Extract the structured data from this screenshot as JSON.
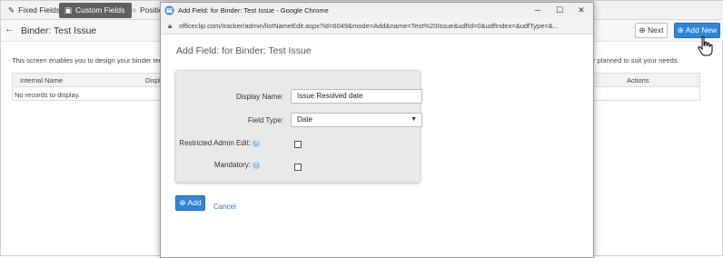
{
  "tabs": [
    {
      "icon": "pencil-icon",
      "label": "Fixed Fields"
    },
    {
      "icon": "save-icon",
      "label": "Custom Fields"
    },
    {
      "icon": "circle-icon",
      "label": "Positio"
    }
  ],
  "header": {
    "title": "Binder: Test Issue",
    "next_label": "Next",
    "add_new_label": "Add New"
  },
  "main": {
    "description_left": "This screen enables you to design your binder temp",
    "description_right": "r planned to suit your needs.",
    "grid": {
      "columns": [
        "Internal Name",
        "Displa",
        "Actions"
      ],
      "empty_text": "No records to display."
    }
  },
  "popup": {
    "window_title": "Add Field: for Binder: Test Issue - Google Chrome",
    "url": "officeclip.com/tracker/admin/listNameEdit.aspx?id=6049&mode=Add&name=Test%20Issue&udfId=0&udfIndex=&udfType=&...",
    "dialog_title": "Add Field: for Binder: Test Issue",
    "form": {
      "display_name_label": "Display Name:",
      "display_name_value": "Issue Resolved date",
      "field_type_label": "Field Type:",
      "field_type_value": "Date",
      "restricted_label": "Restricted Admin Edit:",
      "mandatory_label": "Mandatory:",
      "help_glyph": "?"
    },
    "add_label": "Add",
    "cancel_label": "Cancel"
  },
  "colors": {
    "accent": "#2f86d4",
    "active_tab": "#5f6062"
  }
}
